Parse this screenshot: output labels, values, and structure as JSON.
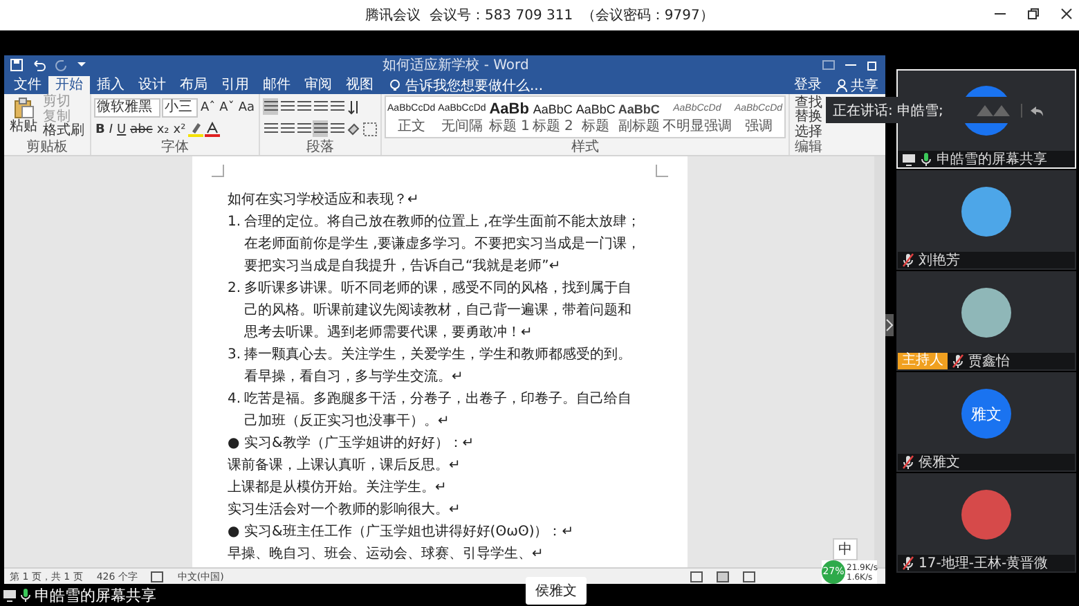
{
  "meeting": {
    "title": "腾讯会议  会议号：583 709 311  （会议密码：9797）"
  },
  "word": {
    "title": "如何适应新学校 - Word",
    "tabs": [
      {
        "label": "文件",
        "selected": false
      },
      {
        "label": "开始",
        "selected": true
      },
      {
        "label": "插入",
        "selected": false
      },
      {
        "label": "设计",
        "selected": false
      },
      {
        "label": "布局",
        "selected": false
      },
      {
        "label": "引用",
        "selected": false
      },
      {
        "label": "邮件",
        "selected": false
      },
      {
        "label": "审阅",
        "selected": false
      },
      {
        "label": "视图",
        "selected": false
      }
    ],
    "tell_me": "告诉我您想要做什么...",
    "sign_in": "登录",
    "share": "共享",
    "ribbon": {
      "clipboard": {
        "paste": "粘贴",
        "items": [
          "剪切",
          "复制",
          "格式刷"
        ],
        "label": "剪贴板"
      },
      "font": {
        "name": "微软雅黑",
        "size": "小三",
        "row1": [
          "Aˆ",
          "Aˇ",
          "Aa"
        ],
        "row2": [
          "B",
          "I",
          "U",
          "abc",
          "x₂",
          "x²"
        ],
        "label": "字体"
      },
      "paragraph": {
        "label": "段落"
      },
      "styles": {
        "label": "样式",
        "items": [
          {
            "sample": "AaBbCcDd",
            "name": "正文",
            "kind": "normal"
          },
          {
            "sample": "AaBbCcDd",
            "name": "无间隔",
            "kind": "normal"
          },
          {
            "sample": "AaBb",
            "name": "标题 1",
            "kind": "heading1"
          },
          {
            "sample": "AaBbC",
            "name": "标题 2",
            "kind": "heading2"
          },
          {
            "sample": "AaBbC",
            "name": "标题",
            "kind": "title"
          },
          {
            "sample": "AaBbC",
            "name": "副标题",
            "kind": "subtitle"
          },
          {
            "sample": "AaBbCcDd",
            "name": "不明显强调",
            "kind": "emphasis"
          },
          {
            "sample": "AaBbCcDd",
            "name": "强调",
            "kind": "emphasis"
          }
        ]
      },
      "editing": {
        "items": [
          "查找",
          "替换",
          "选择"
        ],
        "label": "编辑"
      }
    },
    "document": {
      "paragraphs": [
        {
          "kind": "plain",
          "lines": [
            "如何在实习学校适应和表现？↵"
          ]
        },
        {
          "kind": "numbered",
          "marker": "1.",
          "lines": [
            "合理的定位。将自己放在教师的位置上 ,在学生面前不能太放肆；",
            "在老师面前你是学生 ,要谦虚多学习。不要把实习当成是一门课，",
            "要把实习当成是自我提升，告诉自己“我就是老师”↵"
          ]
        },
        {
          "kind": "numbered",
          "marker": "2.",
          "lines": [
            "多听课多讲课。听不同老师的课，感受不同的风格，找到属于自",
            "己的风格。听课前建议先阅读教材，自己背一遍课，带着问题和",
            "思考去听课。遇到老师需要代课，要勇敢冲！↵"
          ]
        },
        {
          "kind": "numbered",
          "marker": "3.",
          "lines": [
            "捧一颗真心去。关注学生，关爱学生，学生和教师都感受的到。",
            "看早操，看自习，多与学生交流。↵"
          ]
        },
        {
          "kind": "numbered",
          "marker": "4.",
          "lines": [
            "吃苦是福。多跑腿多干活，分卷子，出卷子，印卷子。自己给自",
            "己加班（反正实习也没事干）。↵"
          ]
        },
        {
          "kind": "numbered",
          "marker": "●",
          "lines": [
            "实习&教学（广玉学姐讲的好好）：↵"
          ]
        },
        {
          "kind": "plain",
          "lines": [
            "课前备课，上课认真听，课后反思。↵"
          ]
        },
        {
          "kind": "plain",
          "lines": [
            "上课都是从模仿开始。关注学生。↵"
          ]
        },
        {
          "kind": "plain",
          "lines": [
            "实习生活会对一个教师的影响很大。↵"
          ]
        },
        {
          "kind": "numbered",
          "marker": "●",
          "lines": [
            "实习&班主任工作（广玉学姐也讲得好好(ʘωʘ)）：↵"
          ]
        },
        {
          "kind": "plain",
          "lines": [
            "早操、晚自习、班会、运动会、球赛、引导学生、↵"
          ]
        }
      ]
    },
    "status": {
      "page": "第 1 页，共 1 页",
      "words": "426 个字",
      "language": "中文(中国)"
    }
  },
  "monitor": {
    "ime": "中",
    "cpu": "27%",
    "up": "21.9K/s",
    "down": "1.6K/s"
  },
  "speaking": {
    "label": "正在讲话: 申皓雪;"
  },
  "participants": [
    {
      "name": "申皓雪的屏幕共享",
      "kind": "screen",
      "selected": true,
      "muted": false,
      "screen_share": true
    },
    {
      "name": "刘艳芳",
      "kind": "cartoon",
      "selected": false,
      "muted": true,
      "screen_share": false
    },
    {
      "name": "贾鑫怡",
      "kind": "photo",
      "selected": false,
      "muted": true,
      "screen_share": false,
      "badge": "主持人"
    },
    {
      "name": "侯雅文",
      "kind": "initials",
      "initials": "雅文",
      "selected": false,
      "muted": true,
      "screen_share": false
    },
    {
      "name": "17-地理-王林-黄晋微",
      "kind": "drawing",
      "selected": false,
      "muted": true,
      "screen_share": false
    }
  ],
  "bottom": {
    "share_label": "申皓雪的屏幕共享",
    "tooltip": "侯雅文"
  }
}
